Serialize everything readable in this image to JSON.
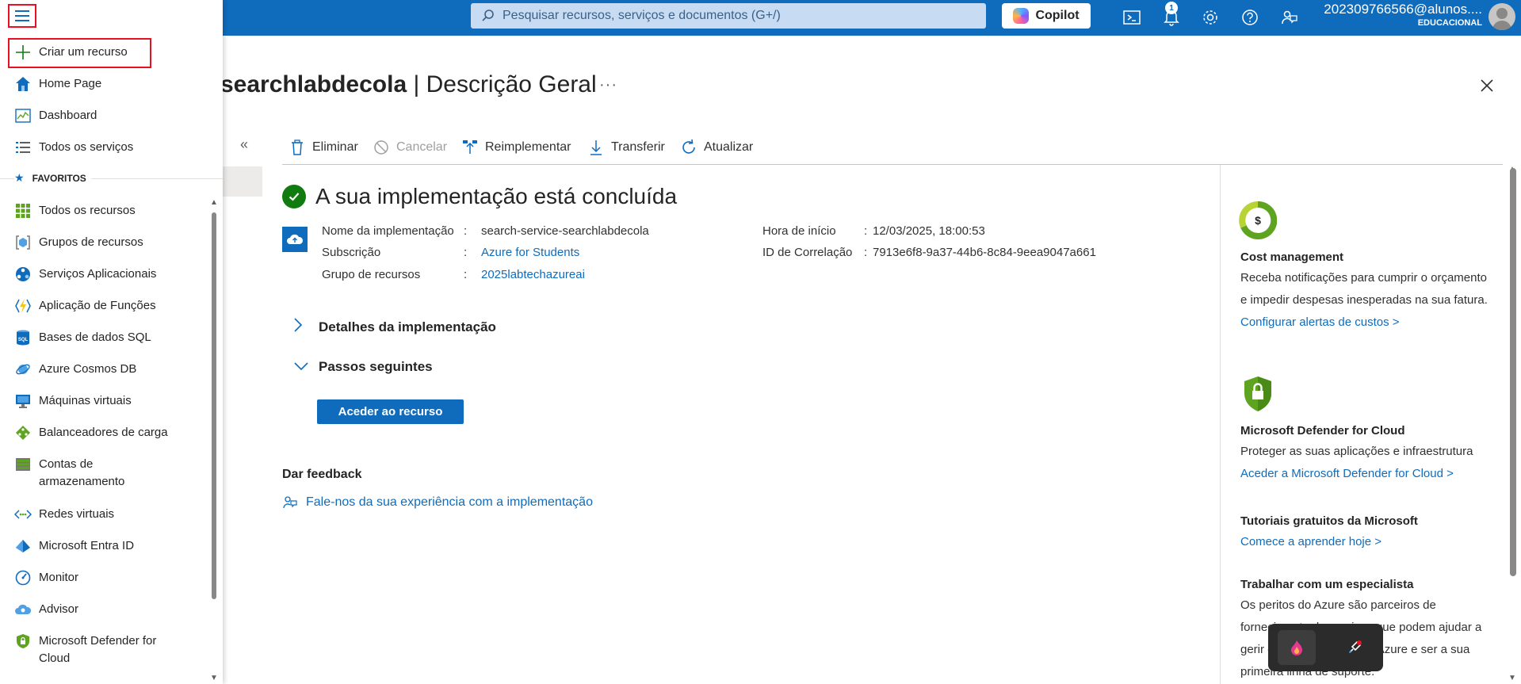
{
  "topbar": {
    "search_placeholder": "Pesquisar recursos, serviços e documentos (G+/)",
    "copilot_label": "Copilot",
    "notification_count": "1",
    "user_email": "202309766566@alunos....",
    "user_tenant": "EDUCACIONAL"
  },
  "flyout": {
    "items_top": [
      {
        "label": "Criar um recurso",
        "icon": "plus-icon"
      },
      {
        "label": "Home Page",
        "icon": "home-icon"
      },
      {
        "label": "Dashboard",
        "icon": "dashboard-icon"
      },
      {
        "label": "Todos os serviços",
        "icon": "list-icon"
      }
    ],
    "favorites_label": "FAVORITOS",
    "favorites": [
      {
        "label": "Todos os recursos",
        "icon": "grid-icon"
      },
      {
        "label": "Grupos de recursos",
        "icon": "resource-group-icon"
      },
      {
        "label": "Serviços Aplicacionais",
        "icon": "app-service-icon"
      },
      {
        "label": "Aplicação de Funções",
        "icon": "lightning-icon"
      },
      {
        "label": "Bases de dados SQL",
        "icon": "sql-icon"
      },
      {
        "label": "Azure Cosmos DB",
        "icon": "cosmos-icon"
      },
      {
        "label": "Máquinas virtuais",
        "icon": "monitor-icon"
      },
      {
        "label": "Balanceadores de carga",
        "icon": "load-balancer-icon"
      },
      {
        "label": "Contas de armazenamento",
        "icon": "storage-icon"
      },
      {
        "label": "Redes virtuais",
        "icon": "vnet-icon"
      },
      {
        "label": "Microsoft Entra ID",
        "icon": "entra-icon"
      },
      {
        "label": "Monitor",
        "icon": "gauge-icon"
      },
      {
        "label": "Advisor",
        "icon": "advisor-icon"
      },
      {
        "label": "Microsoft Defender for Cloud",
        "icon": "shield-icon"
      }
    ]
  },
  "page": {
    "title_bold": "searchlabdecola",
    "title_rest": " | Descrição Geral",
    "more": "···"
  },
  "toolbar": {
    "delete": "Eliminar",
    "cancel": "Cancelar",
    "redeploy": "Reimplementar",
    "download": "Transferir",
    "refresh": "Atualizar"
  },
  "deployment": {
    "status": "A sua implementação está concluída",
    "name_label": "Nome da implementação",
    "name_value": "search-service-searchlabdecola",
    "subscription_label": "Subscrição",
    "subscription_value": "Azure for Students",
    "rg_label": "Grupo de recursos",
    "rg_value": "2025labtechazureai",
    "start_label": "Hora de início",
    "start_value": "12/03/2025, 18:00:53",
    "corr_label": "ID de Correlação",
    "corr_value": "7913e6f8-9a37-44b6-8c84-9eea9047a661",
    "details_label": "Detalhes da implementação",
    "next_steps_label": "Passos seguintes",
    "go_to_resource": "Aceder ao recurso",
    "feedback_title": "Dar feedback",
    "feedback_link": "Fale-nos da sua experiência com a implementação"
  },
  "right_panel": {
    "cost_title": "Cost management",
    "cost_text": "Receba notificações para cumprir o orçamento e impedir despesas inesperadas na sua fatura.",
    "cost_link": "Configurar alertas de custos >",
    "defender_title": "Microsoft Defender for Cloud",
    "defender_text": "Proteger as suas aplicações e infraestrutura",
    "defender_link": "Aceder a Microsoft Defender for Cloud >",
    "tutorials_title": "Tutoriais gratuitos da Microsoft",
    "tutorials_link": "Comece a aprender hoje >",
    "expert_title": "Trabalhar com um especialista",
    "expert_text": "Os peritos do Azure são parceiros de fornecimento de serviços que podem ajudar a gerir os seus recursos no Azure e ser a sua primeira linha de suporte."
  },
  "colors": {
    "brand": "#0f6cbd",
    "success": "#107c10",
    "highlight_border": "#e81123"
  }
}
